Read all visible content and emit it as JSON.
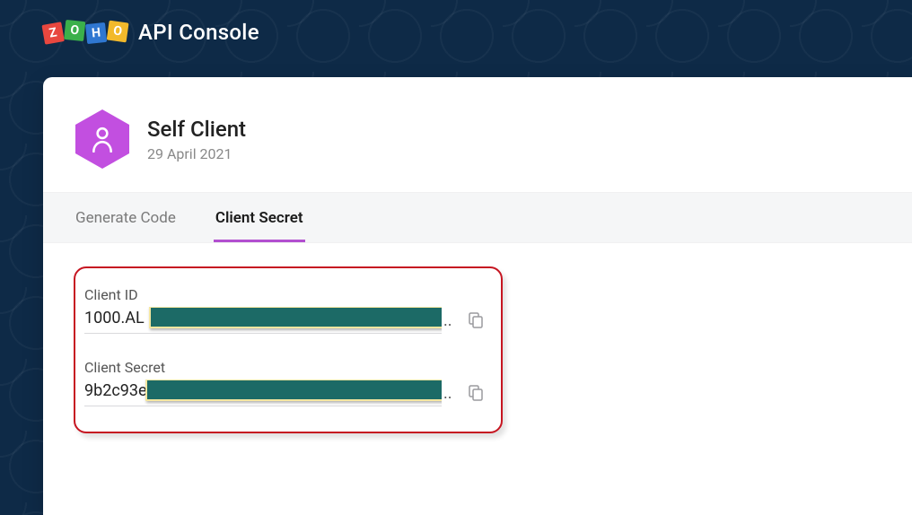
{
  "logo": {
    "letters": [
      "Z",
      "O",
      "H",
      "O"
    ]
  },
  "app_title": "API Console",
  "client": {
    "name": "Self Client",
    "date": "29 April 2021"
  },
  "tabs": {
    "generate": "Generate Code",
    "secret": "Client Secret"
  },
  "fields": {
    "id": {
      "label": "Client ID",
      "value_visible": "1000.AL"
    },
    "secret": {
      "label": "Client Secret",
      "value_visible": "9b2c93e"
    }
  },
  "colors": {
    "accent": "#b24fd0",
    "hexagon": "#c24fe0"
  }
}
